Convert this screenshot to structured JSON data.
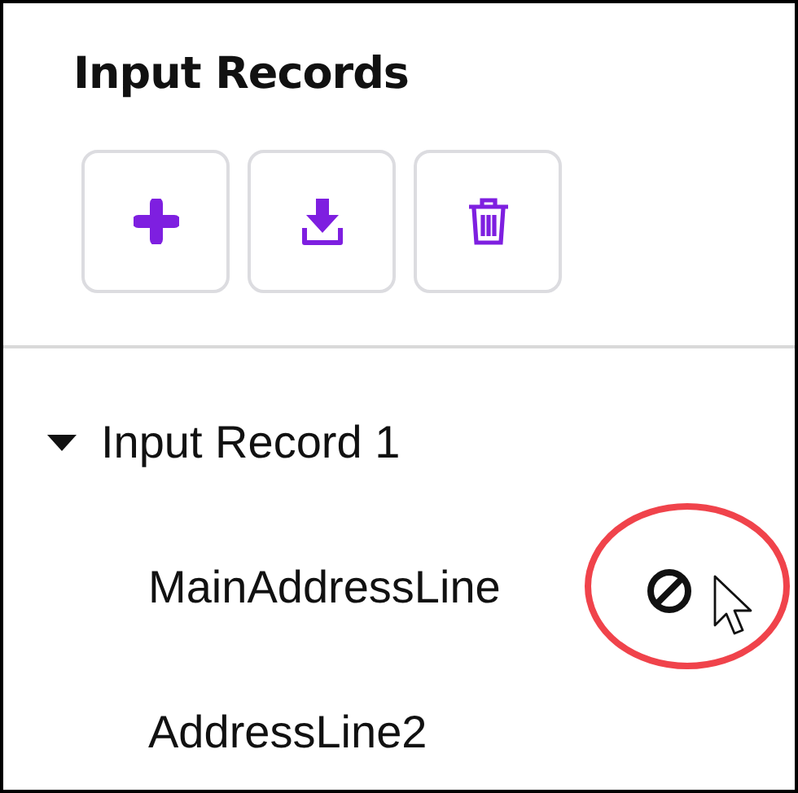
{
  "panel": {
    "title": "Input Records"
  },
  "toolbar": [
    {
      "kind": "add"
    },
    {
      "kind": "download"
    },
    {
      "kind": "delete"
    }
  ],
  "tree": [
    {
      "label": "Input Record 1",
      "expanded": true,
      "children": [
        {
          "label": "MainAddressLine",
          "hovered": true
        },
        {
          "label": "AddressLine2",
          "hovered": false
        }
      ]
    }
  ]
}
